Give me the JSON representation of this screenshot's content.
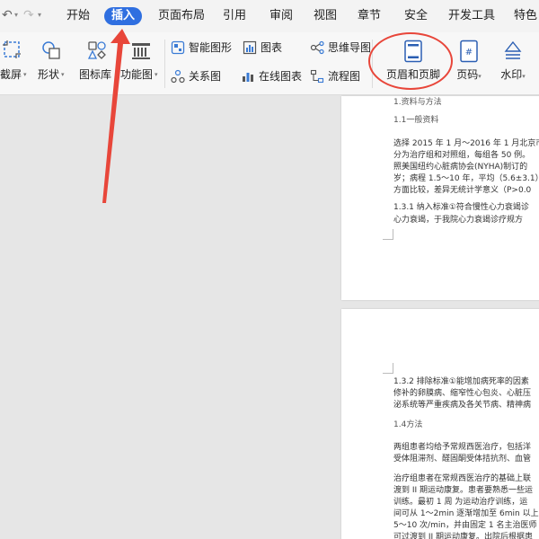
{
  "menubar": {
    "tabs": [
      {
        "label": "开始",
        "active": false
      },
      {
        "label": "插入",
        "active": true
      },
      {
        "label": "页面布局",
        "active": false
      },
      {
        "label": "引用",
        "active": false
      },
      {
        "label": "审阅",
        "active": false
      },
      {
        "label": "视图",
        "active": false
      },
      {
        "label": "章节",
        "active": false
      },
      {
        "label": "安全",
        "active": false
      },
      {
        "label": "开发工具",
        "active": false
      },
      {
        "label": "特色",
        "active": false
      }
    ]
  },
  "toolbar": {
    "screenshot": "截屏",
    "shapes": "形状",
    "icon_library": "图标库",
    "function_chart": "功能图",
    "smart_shape": "智能图形",
    "chart": "图表",
    "mind_map": "思维导图",
    "relation_chart": "关系图",
    "online_chart": "在线图表",
    "flowchart": "流程图",
    "header_footer": "页眉和页脚",
    "page_number": "页码",
    "watermark": "水印"
  },
  "colors": {
    "accent": "#2f6fe0",
    "highlight": "#e8463a"
  },
  "document": {
    "page1_lines": [
      "1.资料与方法",
      "1.1一般资料",
      "选择 2015 年 1 月～2016 年 1 月北京市",
      "分为治疗组和对照组，每组各 50 例。",
      "照美国纽约心脏病协会(NYHA)制订的",
      "岁；病程 1.5～10 年，平均（5.6±3.1）",
      "方面比较，差异无统计学意义（P>0.0",
      "1.3.1 纳入标准①符合慢性心力衰竭诊",
      "心力衰竭，于我院心力衰竭诊疗规方"
    ],
    "page2_lines": [
      "1.3.2 排除标准①能增加病死率的因素",
      "修补的卵膜病、缩窄性心包炎、心脏压",
      "泌系统等严重疾病及各关节病、精神病",
      "1.4方法",
      "两组患者均给予常规西医治疗，包括洋",
      "受体阻滞剂、醛固酮受体拮抗剂、血管",
      "治疗组患者在常规西医治疗的基础上联",
      "渡到 II 期运动康复。患者要熟悉一些运",
      "训练。最初 1 周 为运动治疗训练，运",
      "间可从 1～2min 逐渐增加至 6min 以上",
      "5～10 次/min，并由固定 1 名主治医师",
      "可过渡到 II 期运动康复。出院后根据患"
    ]
  }
}
